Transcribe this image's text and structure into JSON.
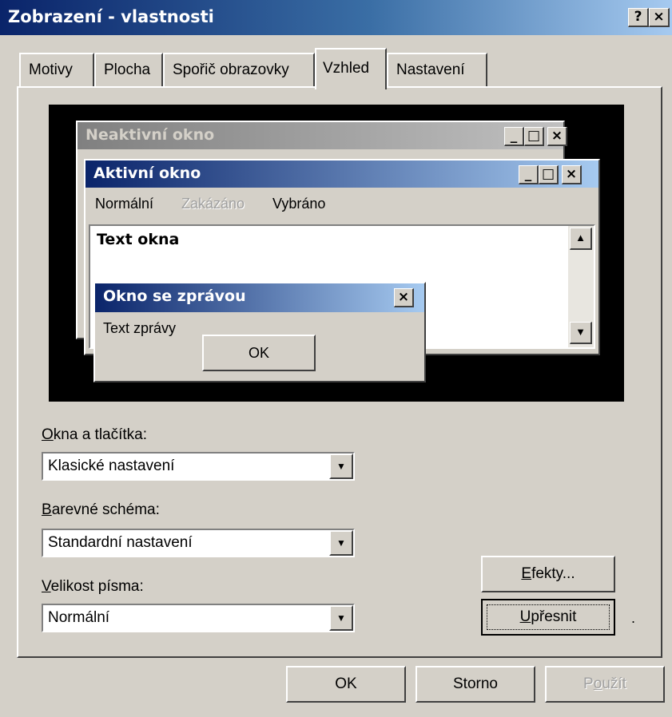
{
  "window": {
    "title": "Zobrazení - vlastnosti",
    "help_btn": "?",
    "close_btn": "×"
  },
  "tabs": [
    {
      "label": "Motivy"
    },
    {
      "label": "Plocha"
    },
    {
      "label": "Spořič obrazovky"
    },
    {
      "label": "Vzhled",
      "active": true
    },
    {
      "label": "Nastavení"
    }
  ],
  "preview": {
    "inactive_title": "Neaktivní okno",
    "active_title": "Aktivní okno",
    "menu": {
      "normal": "Normální",
      "disabled": "Zakázáno",
      "selected": "Vybráno"
    },
    "window_text": "Text okna",
    "msg_title": "Okno se zprávou",
    "msg_text": "Text zprávy",
    "msg_ok": "OK"
  },
  "form": {
    "windows_buttons": {
      "label_u": "O",
      "label_rest": "kna a tlačítka:",
      "value": "Klasické nastavení"
    },
    "color_scheme": {
      "label_u": "B",
      "label_rest": "arevné schéma:",
      "value": "Standardní nastavení"
    },
    "font_size": {
      "label_u": "V",
      "label_rest": "elikost písma:",
      "value": "Normální"
    }
  },
  "buttons": {
    "effects_u": "E",
    "effects_rest": "fekty...",
    "advanced_u": "U",
    "advanced_rest": "přesnit",
    "ok": "OK",
    "cancel": "Storno",
    "apply_pre": "P",
    "apply_u": "o",
    "apply_rest": "užít"
  },
  "colors": {
    "face": "#d4d0c8",
    "active_title_start": "#0a246a",
    "active_title_end": "#a6caf0",
    "inactive_title_start": "#808080",
    "inactive_title_end": "#c0c0c0"
  }
}
